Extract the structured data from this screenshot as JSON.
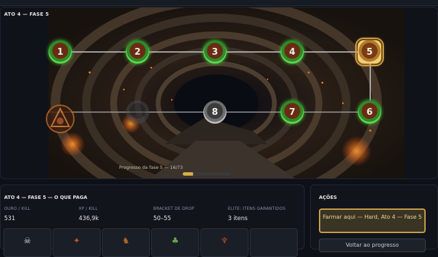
{
  "map": {
    "title": "ATO 4 — FASE 5",
    "progress_label": "Progresso da fase 5 — 16/73",
    "progress_fraction": 0.22,
    "nodes": [
      {
        "label": "1",
        "state": "done"
      },
      {
        "label": "2",
        "state": "done"
      },
      {
        "label": "3",
        "state": "done"
      },
      {
        "label": "4",
        "state": "done"
      },
      {
        "label": "5",
        "state": "current"
      },
      {
        "label": "6",
        "state": "done"
      },
      {
        "label": "7",
        "state": "done"
      },
      {
        "label": "8",
        "state": "locked"
      }
    ]
  },
  "info": {
    "title": "ATO 4 — FASE 5 — O QUE PAGA",
    "stats": [
      {
        "label": "OURO / KILL",
        "value": "531"
      },
      {
        "label": "XP / KILL",
        "value": "436,9k"
      },
      {
        "label": "BRACKET DE DROP",
        "value": "50–55"
      },
      {
        "label": "ELITE: ITENS GARANTIDOS",
        "value": "3 itens"
      }
    ],
    "loot_icons": [
      "skeleton-icon",
      "crab-icon",
      "dragon-icon",
      "goblin-icon",
      "demon-icon"
    ]
  },
  "actions": {
    "title": "AÇÕES",
    "farm_button": "Farmar aqui — Hard, Ato 4 — Fase 5",
    "back_button": "Voltar ao progresso"
  },
  "colors": {
    "node_done": "#62d84d",
    "node_current": "#f1cf70",
    "accent_gold": "#caa04a",
    "progress_fill": "#d3b04a"
  }
}
